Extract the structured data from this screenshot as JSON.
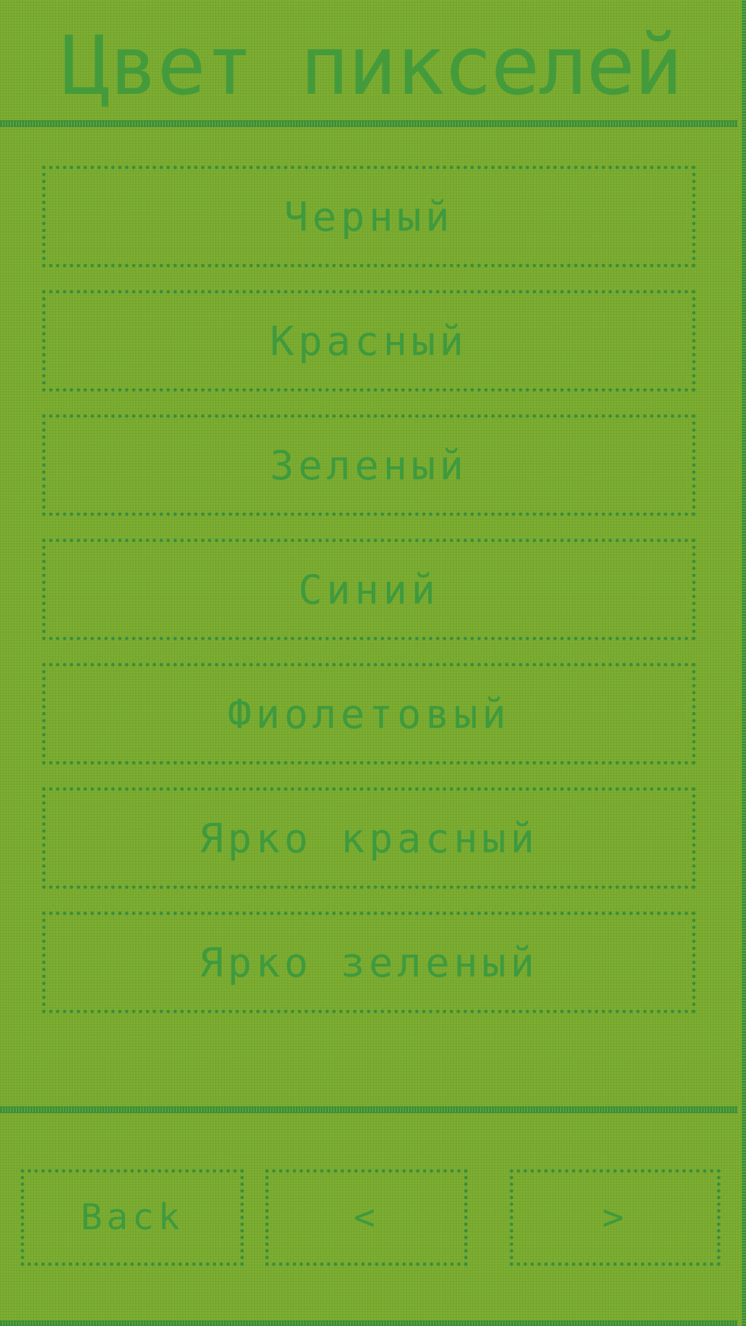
{
  "header": {
    "title": "Цвет пикселей"
  },
  "colors": [
    {
      "label": "Черный"
    },
    {
      "label": "Красный"
    },
    {
      "label": "Зеленый"
    },
    {
      "label": "Синий"
    },
    {
      "label": "Фиолетовый"
    },
    {
      "label": "Ярко красный"
    },
    {
      "label": "Ярко зеленый"
    }
  ],
  "nav": {
    "back_label": "Back",
    "prev_label": "<",
    "next_label": ">"
  },
  "theme": {
    "background": "#7fad31",
    "foreground": "#3a8f3c"
  }
}
